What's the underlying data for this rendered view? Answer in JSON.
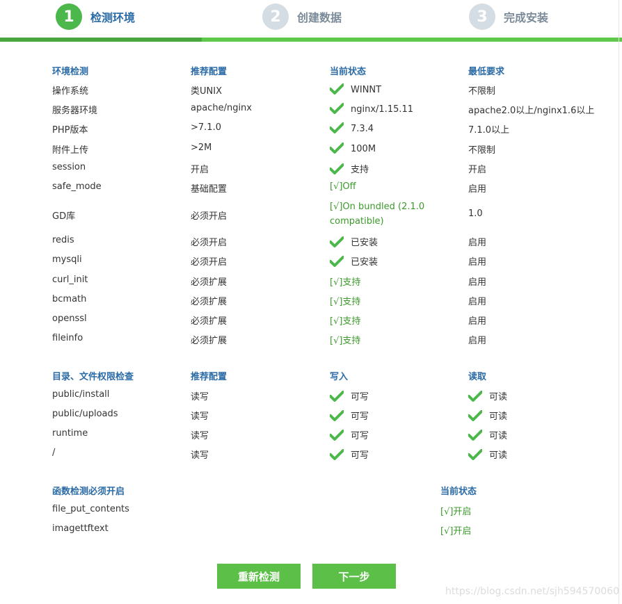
{
  "steps": [
    {
      "num": "1",
      "label": "检测环境"
    },
    {
      "num": "2",
      "label": "创建数据"
    },
    {
      "num": "3",
      "label": "完成安装"
    }
  ],
  "env": {
    "headers": [
      "环境检测",
      "推荐配置",
      "当前状态",
      "最低要求"
    ],
    "rows": [
      [
        "操作系统",
        "类UNIX",
        "WINNT",
        "不限制"
      ],
      [
        "服务器环境",
        "apache/nginx",
        "nginx/1.15.11",
        "apache2.0以上/nginx1.6以上"
      ],
      [
        "PHP版本",
        ">7.1.0",
        "7.3.4",
        "7.1.0以上"
      ],
      [
        "附件上传",
        ">2M",
        "100M",
        "不限制"
      ],
      [
        "session",
        "开启",
        "支持",
        "开启"
      ],
      [
        "safe_mode",
        "基础配置",
        "[√]Off",
        "启用"
      ],
      [
        "GD库",
        "必须开启",
        "[√]On bundled (2.1.0 compatible)",
        "1.0"
      ],
      [
        "redis",
        "必须开启",
        "已安装",
        "启用"
      ],
      [
        "mysqli",
        "必须开启",
        "已安装",
        "启用"
      ],
      [
        "curl_init",
        "必须扩展",
        "[√]支持",
        "启用"
      ],
      [
        "bcmath",
        "必须扩展",
        "[√]支持",
        "启用"
      ],
      [
        "openssl",
        "必须扩展",
        "[√]支持",
        "启用"
      ],
      [
        "fileinfo",
        "必须扩展",
        "[√]支持",
        "启用"
      ]
    ]
  },
  "dirs": {
    "headers": [
      "目录、文件权限检查",
      "推荐配置",
      "写入",
      "读取"
    ],
    "rows": [
      [
        "public/install",
        "读写",
        "可写",
        "可读"
      ],
      [
        "public/uploads",
        "读写",
        "可写",
        "可读"
      ],
      [
        "runtime",
        "读写",
        "可写",
        "可读"
      ],
      [
        "/",
        "读写",
        "可写",
        "可读"
      ]
    ]
  },
  "funcs": {
    "headers": [
      "函数检测必须开启",
      "当前状态"
    ],
    "rows": [
      [
        "file_put_contents",
        "[√]开启"
      ],
      [
        "imagettftext",
        "[√]开启"
      ]
    ]
  },
  "buttons": {
    "recheck": "重新检测",
    "next": "下一步"
  },
  "watermark": "https://blog.csdn.net/sjh594570060",
  "colors": {
    "accent_green": "#5cbf48",
    "header_blue": "#2b6ba5",
    "ok_green": "#3a9a2a"
  },
  "icons": {
    "check": "check-icon"
  }
}
